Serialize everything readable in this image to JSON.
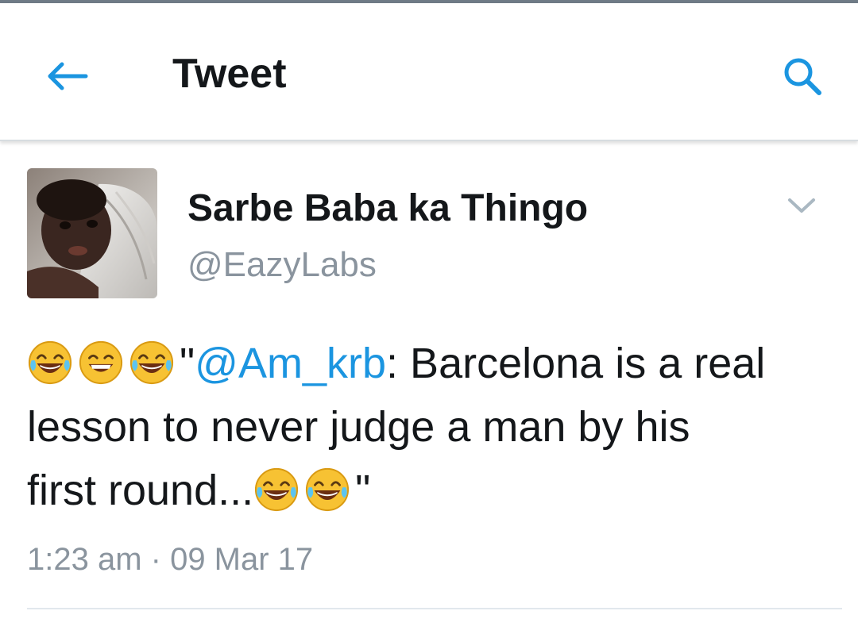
{
  "header": {
    "title": "Tweet",
    "back_icon": "arrow-left-icon",
    "search_icon": "search-icon"
  },
  "tweet": {
    "display_name": "Sarbe Baba ka Thingo",
    "handle": "@EazyLabs",
    "menu_icon": "chevron-down-icon",
    "text_lines": [
      {
        "quote_open": "\"",
        "mention": "@Am_krb",
        "rest": ": Barcelona is a real"
      },
      {
        "text": "lesson to never judge a man by his"
      },
      {
        "text": "first round...",
        "quote_close": "\""
      }
    ],
    "timestamp": "1:23 am · 09 Mar 17"
  },
  "colors": {
    "accent": "#1b95e0",
    "text_primary": "#14171a",
    "text_secondary": "#8a949e",
    "divider": "#e1e8ed"
  }
}
